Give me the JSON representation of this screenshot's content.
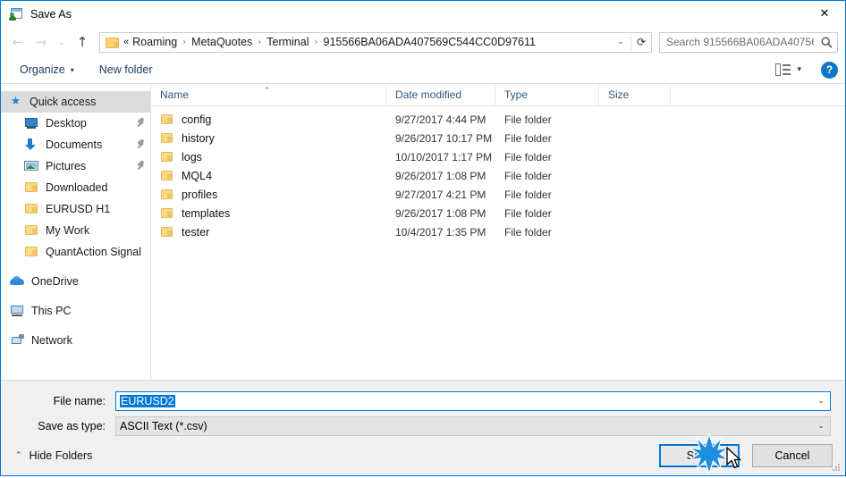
{
  "window": {
    "title": "Save As",
    "icon": "app-icon",
    "close_label": "✕",
    "frame_color": "#0078d7"
  },
  "nav": {
    "back_icon": "←",
    "forward_icon": "→",
    "recent_icon": "⌄",
    "up_icon": "↑",
    "address": {
      "root": "«",
      "crumbs": [
        "Roaming",
        "MetaQuotes",
        "Terminal",
        "915566BA06ADA407569C544CC0D97611"
      ],
      "separator": "›",
      "dropdown_icon": "⌄",
      "refresh_icon": "⟳"
    },
    "search": {
      "placeholder": "Search 915566BA06ADA40756...",
      "value": "",
      "icon": "search-icon"
    }
  },
  "commandbar": {
    "organize_label": "Organize",
    "organize_caret": "▾",
    "new_folder_label": "New folder",
    "view_caret": "▾",
    "help_label": "?"
  },
  "sidebar": {
    "items": [
      {
        "label": "Quick access",
        "icon": "star-icon",
        "selected": true,
        "pinned": false,
        "indent": false
      },
      {
        "label": "Desktop",
        "icon": "desktop-icon",
        "selected": false,
        "pinned": true,
        "indent": true
      },
      {
        "label": "Documents",
        "icon": "documents-icon",
        "selected": false,
        "pinned": true,
        "indent": true
      },
      {
        "label": "Pictures",
        "icon": "pictures-icon",
        "selected": false,
        "pinned": true,
        "indent": true
      },
      {
        "label": "Downloaded",
        "icon": "folder-icon",
        "selected": false,
        "pinned": false,
        "indent": true
      },
      {
        "label": "EURUSD H1",
        "icon": "folder-icon",
        "selected": false,
        "pinned": false,
        "indent": true
      },
      {
        "label": "My Work",
        "icon": "folder-icon",
        "selected": false,
        "pinned": false,
        "indent": true
      },
      {
        "label": "QuantAction Signal",
        "icon": "folder-icon",
        "selected": false,
        "pinned": false,
        "indent": true
      },
      {
        "label": "OneDrive",
        "icon": "onedrive-icon",
        "selected": false,
        "pinned": false,
        "indent": false
      },
      {
        "label": "This PC",
        "icon": "this-pc-icon",
        "selected": false,
        "pinned": false,
        "indent": false
      },
      {
        "label": "Network",
        "icon": "network-icon",
        "selected": false,
        "pinned": false,
        "indent": false
      }
    ]
  },
  "filelist": {
    "columns": [
      "Name",
      "Date modified",
      "Type",
      "Size"
    ],
    "sort_column": "Name",
    "sort_caret": "⌃",
    "rows": [
      {
        "name": "config",
        "date": "9/27/2017 4:44 PM",
        "type": "File folder",
        "size": ""
      },
      {
        "name": "history",
        "date": "9/26/2017 10:17 PM",
        "type": "File folder",
        "size": ""
      },
      {
        "name": "logs",
        "date": "10/10/2017 1:17 PM",
        "type": "File folder",
        "size": ""
      },
      {
        "name": "MQL4",
        "date": "9/26/2017 1:08 PM",
        "type": "File folder",
        "size": ""
      },
      {
        "name": "profiles",
        "date": "9/27/2017 4:21 PM",
        "type": "File folder",
        "size": ""
      },
      {
        "name": "templates",
        "date": "9/26/2017 1:08 PM",
        "type": "File folder",
        "size": ""
      },
      {
        "name": "tester",
        "date": "10/4/2017 1:35 PM",
        "type": "File folder",
        "size": ""
      }
    ]
  },
  "form": {
    "filename_label": "File name:",
    "filename_value": "EURUSD2",
    "filename_selected": true,
    "filetype_label": "Save as type:",
    "filetype_value": "ASCII Text (*.csv)",
    "dropdown_icon": "⌄"
  },
  "footer": {
    "hide_folders_label": "Hide Folders",
    "hide_folders_caret": "⌃",
    "save_label": "Save",
    "cancel_label": "Cancel"
  },
  "colors": {
    "accent": "#0078d7",
    "selection": "#0078d7",
    "folder": "#fcd986",
    "header_text": "#30587c",
    "click_burst": "#1e8fe0"
  }
}
